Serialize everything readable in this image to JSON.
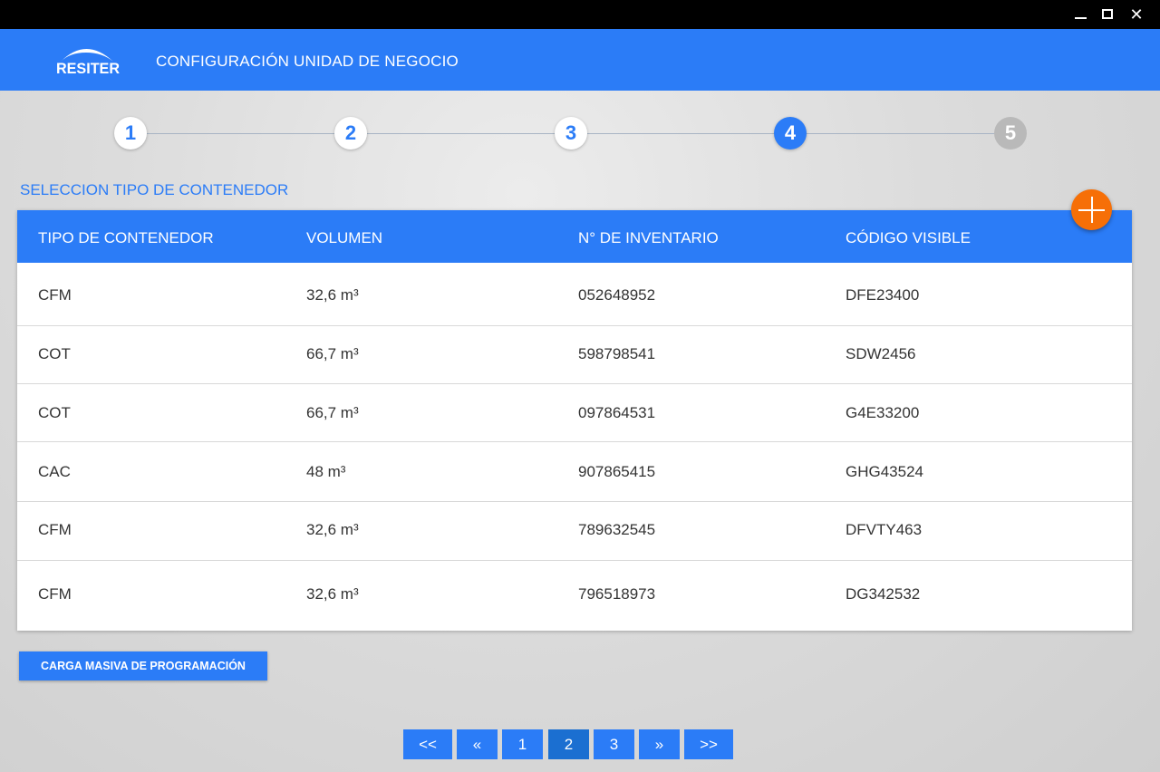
{
  "window": {
    "minimize_icon": "minimize-icon",
    "maximize_icon": "maximize-icon",
    "close_icon": "close-icon",
    "close_glyph": "✕"
  },
  "header": {
    "logo_text": "RESITER",
    "title": "CONFIGURACIÓN UNIDAD DE NEGOCIO",
    "background_color": "#2b7cf7"
  },
  "stepper": {
    "steps": [
      {
        "label": "1",
        "state": "done"
      },
      {
        "label": "2",
        "state": "done"
      },
      {
        "label": "3",
        "state": "done"
      },
      {
        "label": "4",
        "state": "active"
      },
      {
        "label": "5",
        "state": "todo"
      }
    ],
    "current": 4
  },
  "section": {
    "title": "SELECCION TIPO DE CONTENEDOR"
  },
  "table": {
    "columns": [
      "TIPO DE CONTENEDOR",
      "VOLUMEN",
      "N° DE INVENTARIO",
      "CÓDIGO VISIBLE"
    ],
    "rows": [
      [
        "CFM",
        "32,6 m³",
        "052648952",
        "DFE23400"
      ],
      [
        "COT",
        "66,7 m³",
        "598798541",
        "SDW2456"
      ],
      [
        "COT",
        "66,7 m³",
        "097864531",
        "G4E33200"
      ],
      [
        "CAC",
        "48 m³",
        "907865415",
        "GHG43524"
      ],
      [
        "CFM",
        "32,6 m³",
        "789632545",
        "DFVTY463"
      ],
      [
        "CFM",
        "32,6 m³",
        "796518973",
        "DG342532"
      ]
    ]
  },
  "add_button": {
    "icon": "plus-icon",
    "color": "#f66f07"
  },
  "bulk_button": {
    "label": "CARGA MASIVA DE PROGRAMACIÓN"
  },
  "pagination": {
    "first": "<<",
    "prev": "«",
    "pages": [
      "1",
      "2",
      "3"
    ],
    "current_page": "2",
    "next": "»",
    "last": ">>"
  }
}
